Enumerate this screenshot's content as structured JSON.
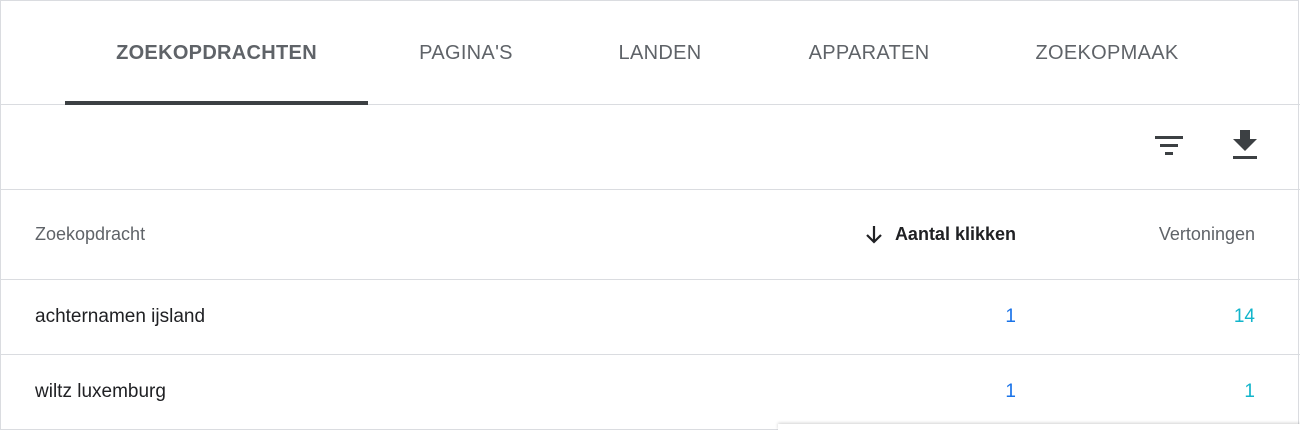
{
  "tabs": [
    {
      "label": "ZOEKOPDRACHTEN",
      "active": true
    },
    {
      "label": "PAGINA'S",
      "active": false
    },
    {
      "label": "LANDEN",
      "active": false
    },
    {
      "label": "APPARATEN",
      "active": false
    },
    {
      "label": "ZOEKOPMAAK",
      "active": false
    }
  ],
  "toolbar": {
    "filter_icon": "filter-icon",
    "download_icon": "download-icon"
  },
  "table": {
    "columns": {
      "query": "Zoekopdracht",
      "clicks": "Aantal klikken",
      "impressions": "Vertoningen"
    },
    "sort": {
      "column": "clicks",
      "direction": "desc",
      "icon": "arrow-down-icon"
    },
    "rows": [
      {
        "query": "achternamen ijsland",
        "clicks": "1",
        "impressions": "14"
      },
      {
        "query": "wiltz luxemburg",
        "clicks": "1",
        "impressions": "1"
      }
    ]
  },
  "colors": {
    "clicks": "#1a73e8",
    "impressions": "#12b5cb",
    "active_tab_indicator": "#3c4043"
  }
}
